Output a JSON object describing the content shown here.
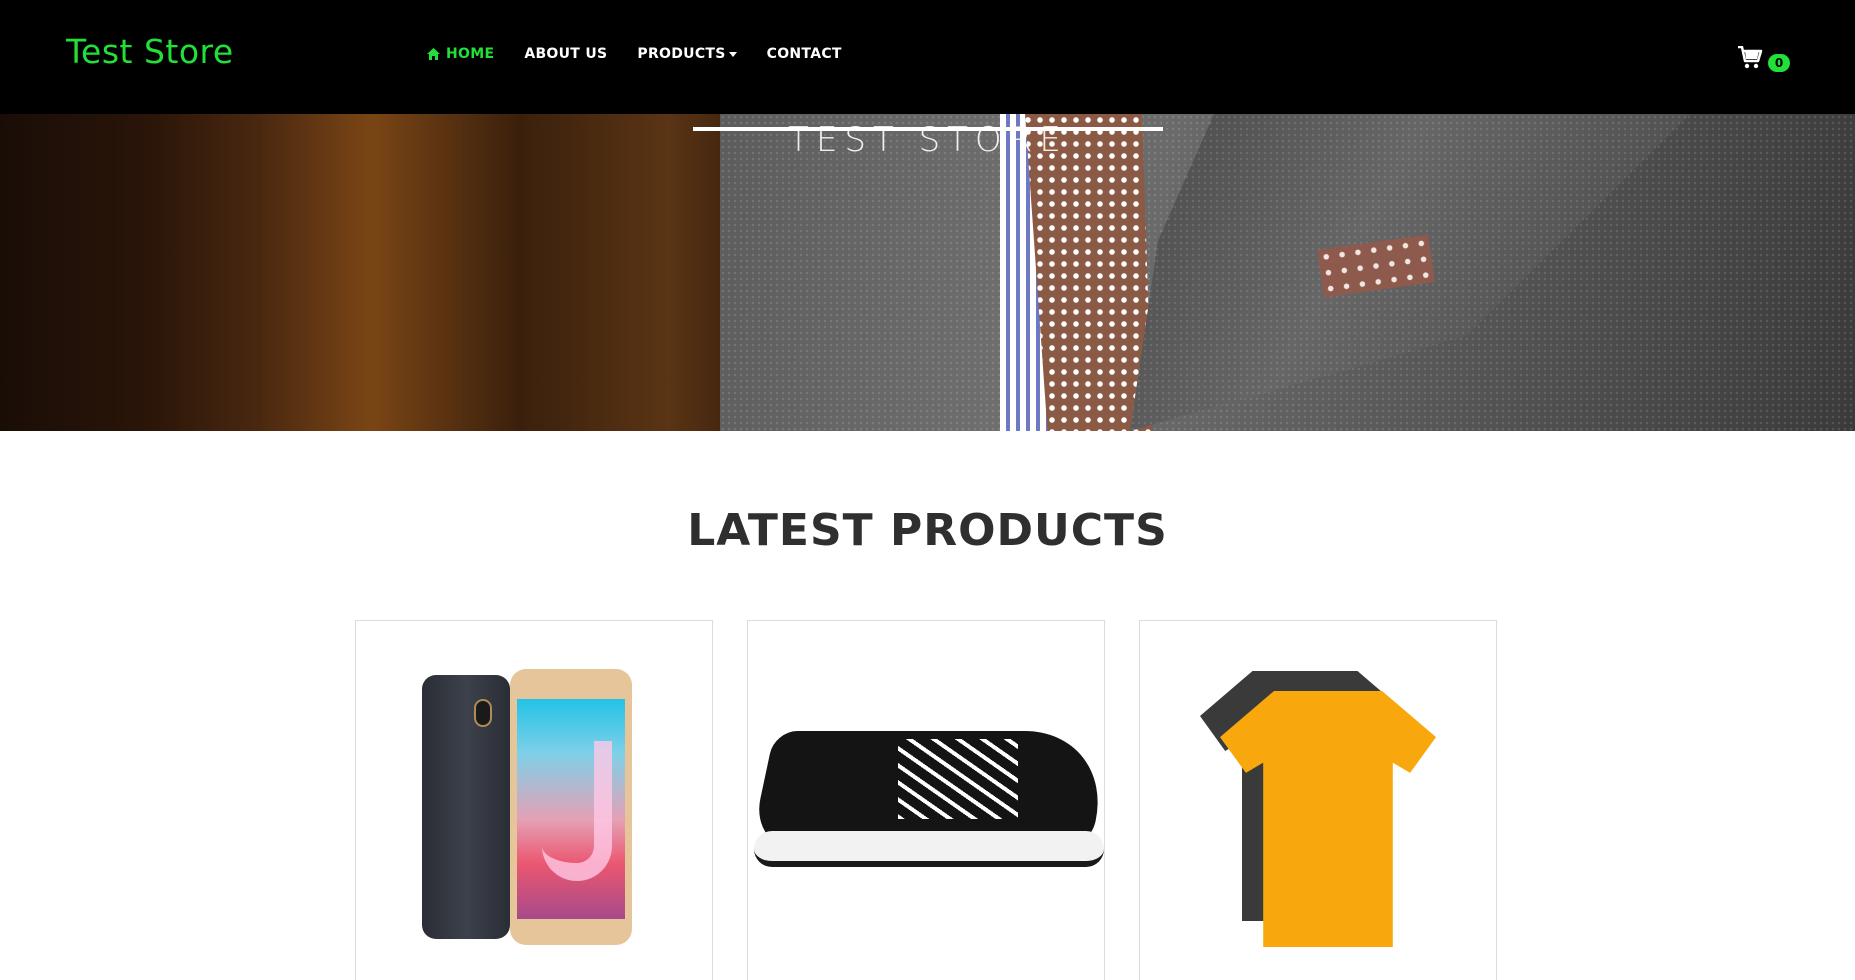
{
  "brand": {
    "name": "Test Store"
  },
  "nav": {
    "items": [
      {
        "label": "HOME",
        "icon": "home-icon",
        "active": true
      },
      {
        "label": "ABOUT US"
      },
      {
        "label": "PRODUCTS",
        "dropdown": true
      },
      {
        "label": "CONTACT"
      }
    ]
  },
  "cart": {
    "icon": "shopping-cart-icon",
    "count": "0"
  },
  "hero": {
    "title": "TEST STORE"
  },
  "products_section": {
    "title": "LATEST PRODUCTS",
    "products": [
      {
        "image": "smartphone-product-image"
      },
      {
        "image": "sneaker-product-image"
      },
      {
        "image": "t-shirt-product-image"
      }
    ]
  },
  "colors": {
    "accent": "#22e03a",
    "navbar_bg": "#000000",
    "heading": "#2f2f2f",
    "card_border": "#dcdcdc"
  }
}
